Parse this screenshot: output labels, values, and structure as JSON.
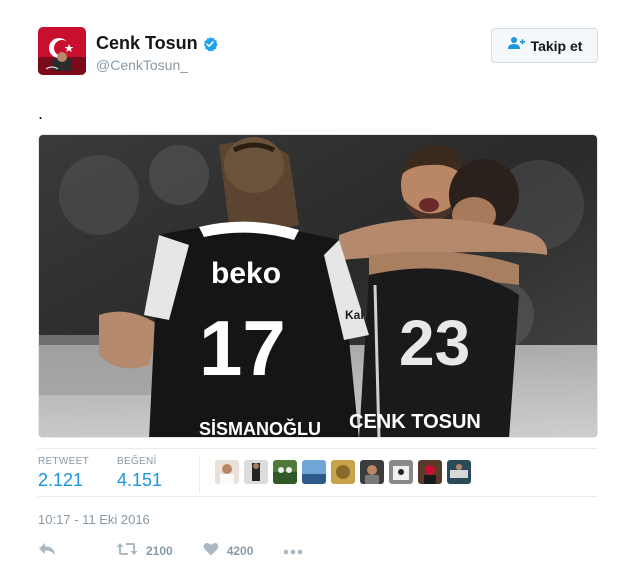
{
  "user": {
    "display_name": "Cenk Tosun",
    "handle": "@CenkTosun_",
    "verified": true
  },
  "follow_button": {
    "label": "Takip et",
    "icon": "add-user-icon"
  },
  "tweet": {
    "text": ".",
    "photo": {
      "jersey_brand": "beko",
      "jersey_number": "17",
      "player_left_name": "SİSMANOĞLU",
      "player_right_name": "CENK TOSUN",
      "sleeve_text": "Kal"
    }
  },
  "stats": {
    "retweet_label": "RETWEET",
    "retweet_value": "2.121",
    "like_label": "BEĞENİ",
    "like_value": "4.151"
  },
  "likers_count": 9,
  "timestamp": "10:17 - 11 Eki 2016",
  "actions": {
    "reply_icon": "reply-icon",
    "retweet_icon": "retweet-icon",
    "retweet_count": "2100",
    "like_icon": "heart-icon",
    "like_count": "4200",
    "more_icon": "more-dots-icon"
  },
  "colors": {
    "link_blue": "#1b95e0",
    "muted": "#8899a6",
    "text": "#14171a",
    "verified": "#1da1f2"
  }
}
